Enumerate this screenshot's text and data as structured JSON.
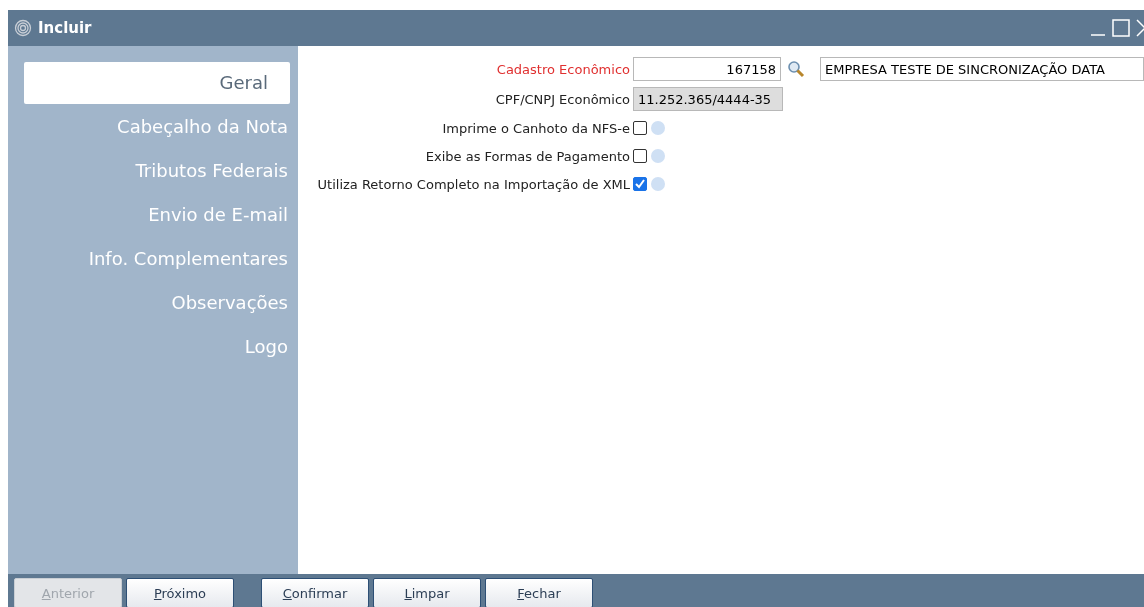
{
  "window": {
    "title": "Incluir"
  },
  "sidebar": {
    "items": [
      {
        "label": "Geral",
        "selected": true
      },
      {
        "label": "Cabeçalho da Nota",
        "selected": false
      },
      {
        "label": "Tributos Federais",
        "selected": false
      },
      {
        "label": "Envio de E-mail",
        "selected": false
      },
      {
        "label": "Info. Complementares",
        "selected": false
      },
      {
        "label": "Observações",
        "selected": false
      },
      {
        "label": "Logo",
        "selected": false
      }
    ]
  },
  "form": {
    "cadastro": {
      "label": "Cadastro Econômico",
      "required": true,
      "value": "167158",
      "name": "EMPRESA TESTE DE SINCRONIZAÇÃO DATA"
    },
    "cpf": {
      "label": "CPF/CNPJ Econômico",
      "value": "11.252.365/4444-35"
    },
    "options": [
      {
        "label": "Imprime o Canhoto da NFS-e",
        "checked": false
      },
      {
        "label": "Exibe as Formas de Pagamento",
        "checked": false
      },
      {
        "label": "Utiliza Retorno Completo na Importação de XML",
        "checked": true
      }
    ]
  },
  "buttons": [
    {
      "label": "Anterior",
      "disabled": true
    },
    {
      "label": "Próximo",
      "disabled": false
    },
    {
      "label": "Confirmar",
      "disabled": false
    },
    {
      "label": "Limpar",
      "disabled": false
    },
    {
      "label": "Fechar",
      "disabled": false
    }
  ]
}
